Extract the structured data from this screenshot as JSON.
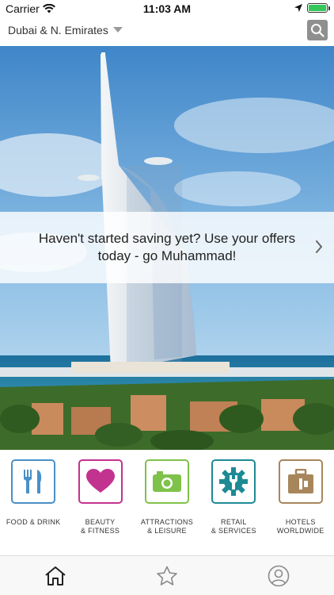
{
  "status_bar": {
    "carrier": "Carrier",
    "time": "11:03 AM",
    "battery_level": 1.0,
    "icons": [
      "wifi-icon",
      "location-arrow-icon",
      "battery-icon"
    ]
  },
  "header": {
    "region": "Dubai & N. Emirates",
    "region_icon": "dropdown-triangle-icon",
    "search_icon": "search-icon"
  },
  "hero": {
    "image": "burj-al-arab-photo",
    "banner_text": "Haven't started saving yet? Use your offers today - go Muhammad!",
    "banner_icon": "chevron-right-icon"
  },
  "categories": [
    {
      "label_line1": "FOOD & DRINK",
      "label_line2": "",
      "icon": "fork-knife-icon",
      "color": "#4a90c8"
    },
    {
      "label_line1": "BEAUTY",
      "label_line2": "& FITNESS",
      "icon": "heart-icon",
      "color": "#c2338f"
    },
    {
      "label_line1": "ATTRACTIONS",
      "label_line2": "& LEISURE",
      "icon": "camera-icon",
      "color": "#7fc24a"
    },
    {
      "label_line1": "RETAIL",
      "label_line2": "& SERVICES",
      "icon": "gear-icon",
      "color": "#1d8a94"
    },
    {
      "label_line1": "HOTELS",
      "label_line2": "WORLDWIDE",
      "icon": "suitcase-icon",
      "color": "#a8865b"
    }
  ],
  "tabbar": {
    "tabs": [
      {
        "icon": "home-icon",
        "active": true
      },
      {
        "icon": "star-icon",
        "active": false
      },
      {
        "icon": "profile-icon",
        "active": false
      }
    ]
  }
}
